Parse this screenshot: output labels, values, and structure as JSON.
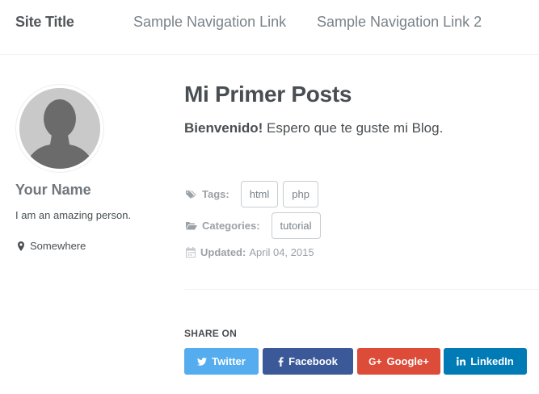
{
  "header": {
    "site_title": "Site Title",
    "nav": [
      {
        "label": "Sample Navigation Link"
      },
      {
        "label": "Sample Navigation Link 2"
      }
    ]
  },
  "author": {
    "name": "Your Name",
    "bio": "I am an amazing person.",
    "location": "Somewhere"
  },
  "post": {
    "title": "Mi Primer Posts",
    "intro_bold": "Bienvenido!",
    "intro_rest": " Espero que te guste mi Blog.",
    "tags_label": "Tags:",
    "tags": [
      "html",
      "php"
    ],
    "categories_label": "Categories:",
    "categories": [
      "tutorial"
    ],
    "updated_label": "Updated:",
    "updated_date": "April 04, 2015"
  },
  "share": {
    "title": "SHARE ON",
    "buttons": [
      {
        "label": "Twitter",
        "color": "#55acee",
        "icon": "twitter-icon"
      },
      {
        "label": "Facebook",
        "color": "#3b5998",
        "icon": "facebook-icon"
      },
      {
        "label": "Google+",
        "color": "#dd4b39",
        "icon": "google-plus-icon"
      },
      {
        "label": "LinkedIn",
        "color": "#007bb6",
        "icon": "linkedin-icon"
      }
    ]
  }
}
